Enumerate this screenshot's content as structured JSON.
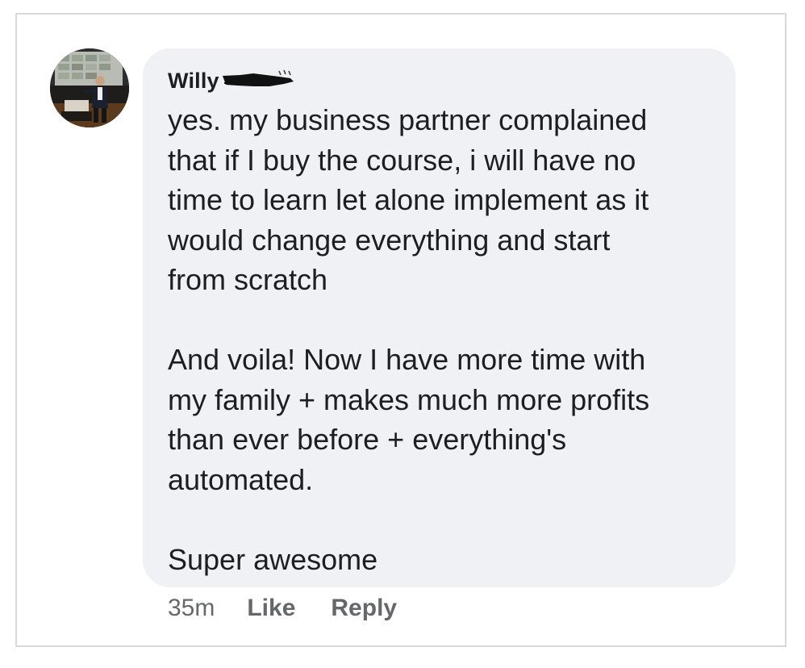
{
  "comment": {
    "author": "Willy",
    "message_paragraphs": [
      "yes. my business partner complained\nthat if I buy the course, i will have no\ntime to learn let alone implement as it\nwould change everything and start\nfrom scratch",
      "And voila! Now I have more time with\nmy family + makes much more profits\nthan ever before + everything's\nautomated.",
      "Super awesome"
    ],
    "timestamp": "35m",
    "like_label": "Like",
    "reply_label": "Reply"
  },
  "colors": {
    "bubble_background": "#f0f1f4",
    "text_primary": "#1c1e21",
    "text_secondary": "#65676b",
    "frame_border": "#d9d9d9"
  },
  "icons": {
    "avatar": "profile-photo-presenter"
  }
}
